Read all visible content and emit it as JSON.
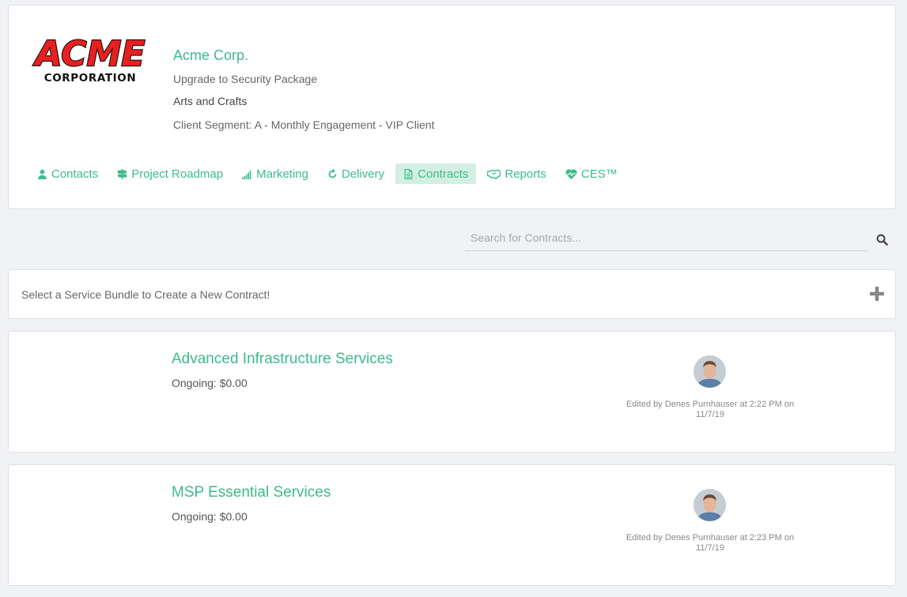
{
  "client": {
    "logo_line1": "ACME",
    "logo_line2": "CORPORATION",
    "name": "Acme Corp.",
    "line1": "Upgrade to Security Package",
    "line2": "Arts and Crafts",
    "segment": "Client Segment: A - Monthly Engagement - VIP Client"
  },
  "nav": [
    {
      "label": "Contacts",
      "icon": "user-icon"
    },
    {
      "label": "Project Roadmap",
      "icon": "signpost-icon"
    },
    {
      "label": "Marketing",
      "icon": "signal-bars-icon"
    },
    {
      "label": "Delivery",
      "icon": "refresh-icon"
    },
    {
      "label": "Contracts",
      "icon": "document-icon",
      "active": true
    },
    {
      "label": "Reports",
      "icon": "handshake-icon"
    },
    {
      "label": "CES™",
      "icon": "heart-pulse-icon"
    }
  ],
  "search": {
    "placeholder": "Search for Contracts..."
  },
  "bundle": {
    "label": "Select a Service Bundle to Create a New Contract!"
  },
  "contracts": [
    {
      "title": "Advanced Infrastructure Services",
      "amount": "Ongoing: $0.00",
      "edited_line1": "Edited by Denes Purnhauser at 2:22 PM on",
      "edited_line2": "11/7/19"
    },
    {
      "title": "MSP Essential Services",
      "amount": "Ongoing: $0.00",
      "edited_line1": "Edited by Denes Purnhauser at 2:23 PM on",
      "edited_line2": "11/7/19"
    }
  ],
  "colors": {
    "accent": "#3dbb8a",
    "active_bg": "#d3efe3",
    "logo_red": "#e8201f"
  }
}
